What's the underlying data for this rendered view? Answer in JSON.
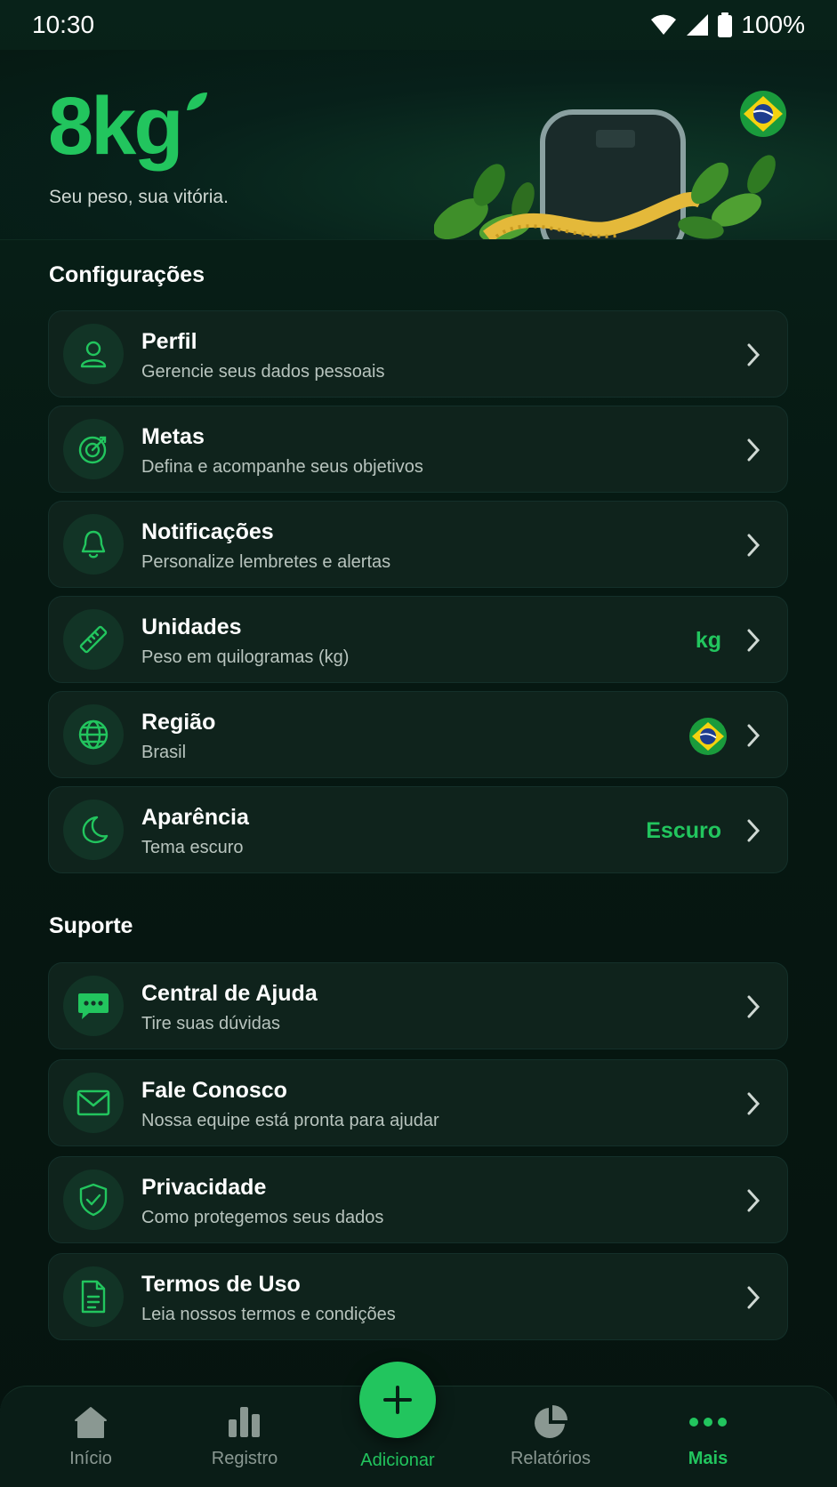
{
  "status_bar": {
    "time": "10:30",
    "battery": "100%",
    "icons": [
      "wifi-icon",
      "signal-icon",
      "battery-icon"
    ]
  },
  "header": {
    "logo": "8kg",
    "tagline": "Seu peso, sua vitória.",
    "region_flag": "brazil-flag-icon"
  },
  "sections": {
    "settings": {
      "title": "Configurações",
      "items": [
        {
          "title": "Perfil",
          "subtitle": "Gerencie seus dados pessoais",
          "icon": "user-icon"
        },
        {
          "title": "Metas",
          "subtitle": "Defina e acompanhe seus objetivos",
          "icon": "target-icon"
        },
        {
          "title": "Notificações",
          "subtitle": "Personalize lembretes e alertas",
          "icon": "bell-icon"
        },
        {
          "title": "Unidades",
          "subtitle": "Peso em quilogramas (kg)",
          "icon": "ruler-icon",
          "value": "kg"
        },
        {
          "title": "Região",
          "subtitle": "Brasil",
          "icon": "globe-icon",
          "value_icon": "brazil-flag-icon"
        },
        {
          "title": "Aparência",
          "subtitle": "Tema escuro",
          "icon": "moon-icon",
          "value": "Escuro"
        }
      ]
    },
    "support": {
      "title": "Suporte",
      "items": [
        {
          "title": "Central de Ajuda",
          "subtitle": "Tire suas dúvidas",
          "icon": "chat-icon"
        },
        {
          "title": "Fale Conosco",
          "subtitle": "Nossa equipe está pronta para ajudar",
          "icon": "mail-icon"
        },
        {
          "title": "Privacidade",
          "subtitle": "Como protegemos seus dados",
          "icon": "shield-icon"
        },
        {
          "title": "Termos de Uso",
          "subtitle": "Leia nossos termos e condições",
          "icon": "document-icon"
        }
      ]
    }
  },
  "bottom_nav": {
    "items": [
      {
        "label": "Início",
        "icon": "home-icon"
      },
      {
        "label": "Registro",
        "icon": "bar-chart-icon"
      },
      {
        "label": "Adicionar",
        "icon": "plus-icon"
      },
      {
        "label": "Relatórios",
        "icon": "pie-chart-icon"
      },
      {
        "label": "Mais",
        "icon": "more-icon"
      }
    ],
    "active": "Mais"
  },
  "colors": {
    "accent": "#22c55e",
    "background": "#071a14",
    "card": "#0f231c",
    "muted_text": "#b8c4be"
  }
}
